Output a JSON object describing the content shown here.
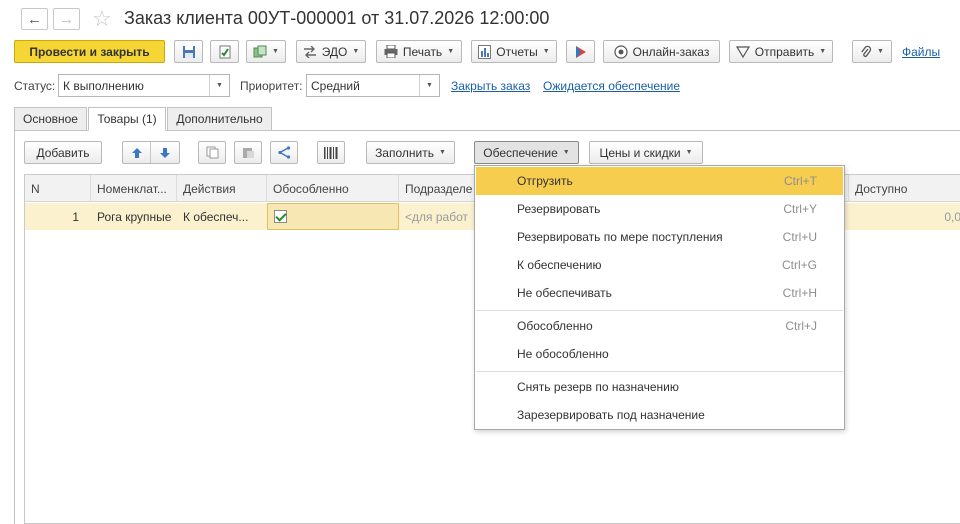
{
  "window": {
    "title": "Заказ клиента 00УТ-000001 от 31.07.2026 12:00:00"
  },
  "toolbar": {
    "post_close": "Провести и закрыть",
    "edo": "ЭДО",
    "print": "Печать",
    "reports": "Отчеты",
    "online_order": "Онлайн-заказ",
    "send": "Отправить",
    "files": "Файлы"
  },
  "status_bar": {
    "status_label": "Статус:",
    "status_value": "К выполнению",
    "priority_label": "Приоритет:",
    "priority_value": "Средний",
    "close_order_link": "Закрыть заказ",
    "awaiting_link": "Ожидается обеспечение"
  },
  "tabs": [
    {
      "label": "Основное"
    },
    {
      "label": "Товары (1)"
    },
    {
      "label": "Дополнительно"
    }
  ],
  "goods_toolbar": {
    "add": "Добавить",
    "fill": "Заполнить",
    "supply": "Обеспечение",
    "prices": "Цены и скидки"
  },
  "grid": {
    "columns": [
      "N",
      "Номенклат...",
      "Действия",
      "Обособленно",
      "Подразделе",
      "Доступно"
    ],
    "rows": [
      {
        "n": "1",
        "item": "Рога крупные",
        "action": "К обеспеч...",
        "separate": true,
        "division": "<для работ",
        "available": "0,0"
      }
    ]
  },
  "supply_menu": {
    "items": [
      {
        "label": "Отгрузить",
        "shortcut": "Ctrl+T"
      },
      {
        "label": "Резервировать",
        "shortcut": "Ctrl+Y"
      },
      {
        "label": "Резервировать по мере поступления",
        "shortcut": "Ctrl+U"
      },
      {
        "label": "К обеспечению",
        "shortcut": "Ctrl+G"
      },
      {
        "label": "Не обеспечивать",
        "shortcut": "Ctrl+H"
      },
      {
        "label": "Обособленно",
        "shortcut": "Ctrl+J"
      },
      {
        "label": "Не обособленно",
        "shortcut": ""
      },
      {
        "label": "Снять резерв по назначению",
        "shortcut": ""
      },
      {
        "label": "Зарезервировать под назначение",
        "shortcut": ""
      }
    ]
  },
  "colors": {
    "primary_button": "#f5d634",
    "menu_highlight": "#f6cd4e",
    "row_highlight": "#fbf1cf",
    "link": "#1a5ea8"
  }
}
